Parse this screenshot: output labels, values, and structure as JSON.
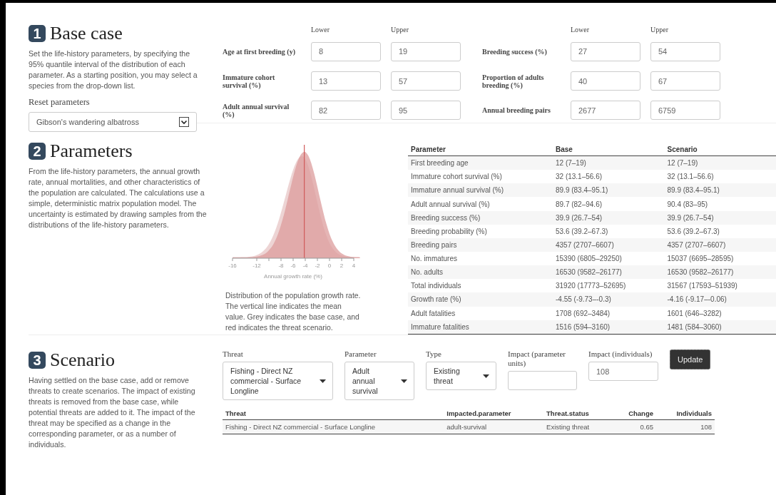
{
  "base_case": {
    "number": "1",
    "title": "Base case",
    "description": "Set the life-history parameters, by specifying the 95% quantile interval of the distribution of each parameter. As a starting position, you may select a species from the drop-down list.",
    "reset_label": "Reset parameters",
    "species": "Gibson's wandering albatross",
    "groups": [
      {
        "headers": [
          "Lower",
          "Upper"
        ],
        "rows": [
          {
            "label": "Age at first breeding (y)",
            "lower": "8",
            "upper": "19"
          },
          {
            "label": "Immature cohort survival (%)",
            "lower": "13",
            "upper": "57"
          },
          {
            "label": "Adult annual survival (%)",
            "lower": "82",
            "upper": "95"
          }
        ]
      },
      {
        "headers": [
          "Lower",
          "Upper"
        ],
        "rows": [
          {
            "label": "Breeding success (%)",
            "lower": "27",
            "upper": "54"
          },
          {
            "label": "Proportion of adults breeding (%)",
            "lower": "40",
            "upper": "67"
          },
          {
            "label": "Annual breeding pairs",
            "lower": "2677",
            "upper": "6759"
          }
        ]
      }
    ]
  },
  "parameters": {
    "number": "2",
    "title": "Parameters",
    "description": "From the life-history parameters, the annual growth rate, annual mortalities, and other characteristics of the population are calculated. The calculations use a simple, deterministic matrix population model. The uncertainty is estimated by drawing samples from the distributions of the life-history parameters.",
    "figure": {
      "xlabel": "Annual growth rate (%)",
      "xticks": [
        "-16",
        "-12",
        "-8",
        "-6",
        "-4",
        "-2",
        "0",
        "2",
        "4"
      ],
      "caption": "Distribution of the population growth rate. The vertical line indicates the mean value. Grey indicates the base case, and red indicates the threat scenario."
    },
    "table": {
      "columns": [
        "Parameter",
        "Base",
        "Scenario"
      ],
      "rows": [
        [
          "First breeding age",
          "12 (7–19)",
          "12 (7–19)"
        ],
        [
          "Immature cohort survival (%)",
          "32 (13.1–56.6)",
          "32 (13.1–56.6)"
        ],
        [
          "Immature annual survival (%)",
          "89.9 (83.4–95.1)",
          "89.9 (83.4–95.1)"
        ],
        [
          "Adult annual survival (%)",
          "89.7 (82–94.6)",
          "90.4 (83–95)"
        ],
        [
          "Breeding success (%)",
          "39.9 (26.7–54)",
          "39.9 (26.7–54)"
        ],
        [
          "Breeding probability (%)",
          "53.6 (39.2–67.3)",
          "53.6 (39.2–67.3)"
        ],
        [
          "Breeding pairs",
          "4357 (2707–6607)",
          "4357 (2707–6607)"
        ],
        [
          "No. immatures",
          "15390 (6805–29250)",
          "15037 (6695–28595)"
        ],
        [
          "No. adults",
          "16530 (9582–26177)",
          "16530 (9582–26177)"
        ],
        [
          "Total individuals",
          "31920 (17773–52695)",
          "31567 (17593–51939)"
        ],
        [
          "Growth rate (%)",
          "-4.55 (-9.73–-0.3)",
          "-4.16 (-9.17–-0.06)"
        ],
        [
          "Adult fatalities",
          "1708 (692–3484)",
          "1601 (646–3282)"
        ],
        [
          "Immature fatalities",
          "1516 (594–3160)",
          "1481 (584–3060)"
        ]
      ]
    }
  },
  "scenario": {
    "number": "3",
    "title": "Scenario",
    "description": "Having settled on the base case, add or remove threats to create scenarios. The impact of existing threats is removed from the base case, while potential threats are added to it. The impact of the threat may be specified as a change in the corresponding parameter, or as a number of individuals.",
    "controls": [
      {
        "kind": "select",
        "label": "Threat",
        "value": "Fishing - Direct NZ commercial - Surface Longline"
      },
      {
        "kind": "select",
        "label": "Parameter",
        "value": "Adult annual survival"
      },
      {
        "kind": "select",
        "label": "Type",
        "value": "Existing threat"
      },
      {
        "kind": "input",
        "label": "Impact (parameter units)"
      },
      {
        "kind": "input",
        "label": "Impact (individuals)",
        "value": "108"
      },
      {
        "kind": "button",
        "label": "Update"
      }
    ],
    "table": {
      "columns": [
        "Threat",
        "Impacted.parameter",
        "Threat.status",
        "Change",
        "Individuals"
      ],
      "rows": [
        [
          "Fishing - Direct NZ commercial - Surface Longline",
          "adult-survival",
          "Existing threat",
          "0.65",
          "108"
        ]
      ]
    }
  }
}
